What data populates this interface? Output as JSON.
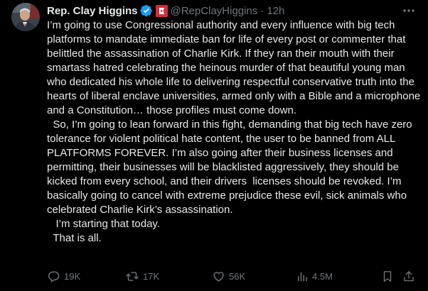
{
  "author": {
    "display_name": "Rep. Clay Higgins",
    "handle": "@RepClayHiggins",
    "separator": "·",
    "time": "12h",
    "avatar_icon": "portrait-avatar",
    "badges": [
      "verified-badge-icon",
      "congress-seal-flag-icon"
    ]
  },
  "tweet": {
    "paragraphs": [
      "I’m going to use Congressional authority and every influence with big tech platforms to mandate immediate ban for life of every post or commenter that belittled the assassination of Charlie Kirk. If they ran their mouth with their smartass hatred celebrating the heinous murder of that beautiful young man who dedicated his whole life to delivering respectful conservative truth into the hearts of liberal enclave universities, armed only with a Bible and a microphone and a Constitution… those profiles must come down.",
      "  So, I’m going to lean forward in this fight, demanding that big tech have zero tolerance for violent political hate content, the user to be banned from ALL PLATFORMS FOREVER. I’m also going after their business licenses and permitting, their businesses will be blacklisted aggressively, they should be kicked from every school, and their drivers  licenses should be revoked. I’m basically going to cancel with extreme prejudice these evil, sick animals who celebrated Charlie Kirk’s assassination.",
      "   I’m starting that today.",
      "  That is all."
    ]
  },
  "actions": {
    "replies": "19K",
    "reposts": "17K",
    "likes": "56K",
    "views": "4.5M"
  },
  "colors": {
    "background": "#000000",
    "text": "#e7e9ea",
    "secondary": "#71767b",
    "verified": "#1d9bf0",
    "flag": "#d32e3a"
  }
}
